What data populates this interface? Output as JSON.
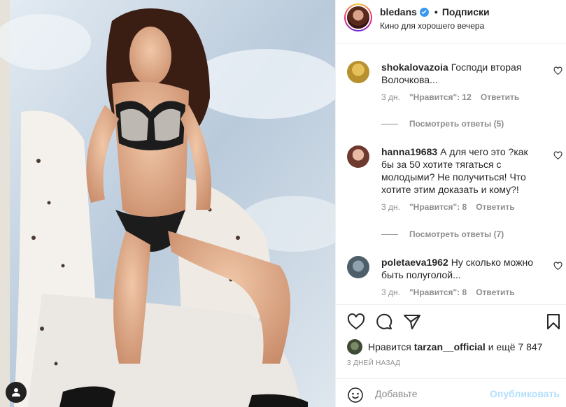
{
  "post": {
    "username": "bledans",
    "follow_separator": "•",
    "follow_label": "Подписки",
    "location": "Кино для хорошего вечера"
  },
  "comments": [
    {
      "user": "shokalovazoia",
      "text": "Господи вторая Волочкова...",
      "time": "3 дн.",
      "likes": "\"Нравится\": 12",
      "reply": "Ответить",
      "view_replies": "Посмотреть ответы (5)",
      "avatar_color": "#c8a640"
    },
    {
      "user": "hanna19683",
      "text": "А для чего это ?как бы за 50 хотите тягаться с молодыми? Не получиться! Что хотите этим доказать и кому?!",
      "time": "3 дн.",
      "likes": "\"Нравится\": 8",
      "reply": "Ответить",
      "view_replies": "Посмотреть ответы (7)",
      "avatar_color": "#b86a5a"
    },
    {
      "user": "poletaeva1962",
      "text": "Ну сколько можно быть полуголой...",
      "time": "3 дн.",
      "likes": "\"Нравится\": 8",
      "reply": "Ответить",
      "avatar_color": "#6a7d8c"
    }
  ],
  "likes_line": {
    "prefix": "Нравится",
    "user": "tarzan__official",
    "suffix": "и ещё 7 847"
  },
  "date": "3 ДНЕЙ НАЗАД",
  "add_comment": {
    "placeholder": "Добавьте",
    "publish_label": "Опубликовать"
  },
  "colors": {
    "verified": "#3897f0",
    "publish_disabled": "#b2dffc",
    "muted": "#8e8e8e"
  }
}
